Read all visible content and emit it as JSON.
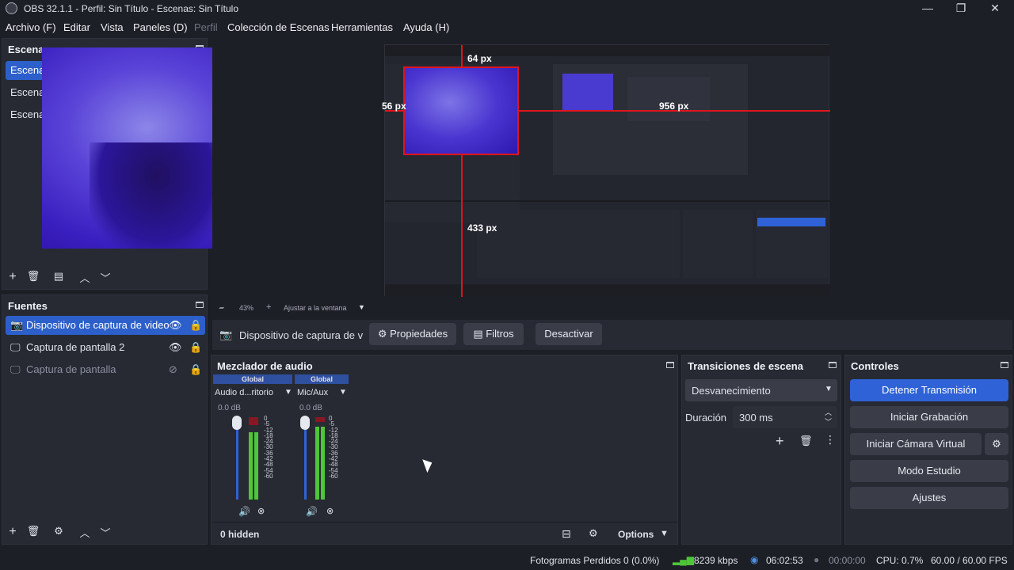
{
  "window": {
    "title": "OBS 32.1.1 - Perfil: Sin Título - Escenas: Sin Título",
    "minimize": "—",
    "maximize": "❐",
    "close": "✕"
  },
  "menu": [
    "Archivo (F)",
    "Editar",
    "Vista",
    "Paneles (D)",
    "Perfil",
    "Colección de Escenas",
    "Herramientas",
    "Ayuda (H)"
  ],
  "scenes": {
    "title": "Escenas",
    "items": [
      "Escena",
      "Escena",
      "Escena"
    ]
  },
  "preview": {
    "zoom": "43%",
    "fit_label": "Ajustar a la ventana",
    "measure_top": "64 px",
    "measure_left": "56 px",
    "measure_right": "956 px",
    "measure_bottom": "433 px"
  },
  "source_toolbar": {
    "source_name": "Dispositivo de captura de v",
    "properties": "Propiedades",
    "filters": "Filtros",
    "deactivate": "Desactivar"
  },
  "sources": {
    "title": "Fuentes",
    "items": [
      "Dispositivo de captura de video",
      "Captura de pantalla 2",
      "Captura de pantalla"
    ]
  },
  "mixer": {
    "title": "Mezclador de audio",
    "channels": [
      {
        "badge": "Global",
        "name": "Audio d...ritorio",
        "db": "0.0 dB",
        "level_l": 0.82,
        "level_r": 0.82
      },
      {
        "badge": "Global",
        "name": "Mic/Aux",
        "db": "0.0 dB",
        "level_l": 0.88,
        "level_r": 0.88
      }
    ],
    "scale": [
      "0",
      "-5",
      "-12",
      "-18",
      "-24",
      "-30",
      "-36",
      "-42",
      "-48",
      "-54",
      "-60"
    ],
    "hidden": "0 hidden",
    "options": "Options"
  },
  "transitions": {
    "title": "Transiciones de escena",
    "selected": "Desvanecimiento",
    "duration_label": "Duración",
    "duration_value": "300 ms"
  },
  "controls": {
    "title": "Controles",
    "stop_stream": "Detener Transmisión",
    "start_record": "Iniciar Grabación",
    "virtual_cam": "Iniciar Cámara Virtual",
    "studio_mode": "Modo Estudio",
    "settings": "Ajustes"
  },
  "status": {
    "dropped": "Fotogramas Perdidos 0 (0.0%)",
    "bitrate": "8239 kbps",
    "stream_time": "06:02:53",
    "record_time": "00:00:00",
    "cpu": "CPU: 0.7%",
    "fps": "60.00 / 60.00 FPS"
  },
  "colors": {
    "accent": "#2f62d6",
    "meter": "#4fc53a",
    "measure": "#e0141e"
  }
}
